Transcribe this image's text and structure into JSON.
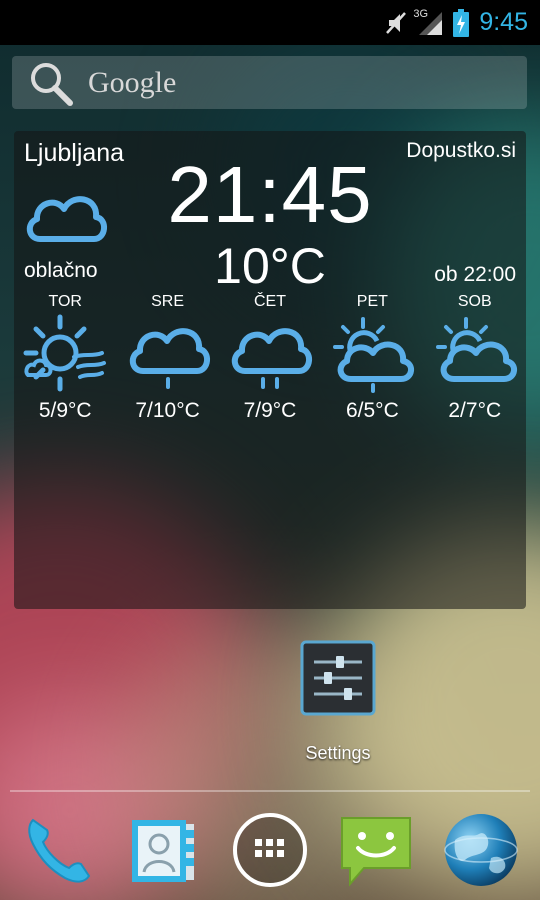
{
  "status_bar": {
    "network_label": "3G",
    "time": "9:45",
    "icons": [
      "muted-icon",
      "signal-icon",
      "battery-charging-icon"
    ]
  },
  "search": {
    "placeholder": "Google"
  },
  "weather": {
    "city": "Ljubljana",
    "provider": "Dopustko.si",
    "clock": "21:45",
    "temperature": "10°C",
    "condition": "oblačno",
    "updated": "ob 22:00",
    "current_icon": "cloud-icon",
    "forecast": [
      {
        "day": "TOR",
        "range": "5/9°C",
        "icon": "sun-cloud-wind-icon"
      },
      {
        "day": "SRE",
        "range": "7/10°C",
        "icon": "cloud-rain-icon"
      },
      {
        "day": "ČET",
        "range": "7/9°C",
        "icon": "cloud-rain-icon"
      },
      {
        "day": "PET",
        "range": "6/5°C",
        "icon": "partly-cloudy-icon"
      },
      {
        "day": "SOB",
        "range": "2/7°C",
        "icon": "partly-cloudy-icon"
      }
    ]
  },
  "shortcuts": {
    "settings_label": "Settings"
  },
  "dock": {
    "items": [
      "phone-icon",
      "contacts-icon",
      "app-drawer-icon",
      "messaging-icon",
      "browser-icon"
    ]
  },
  "colors": {
    "accent": "#33b5e5",
    "weather_icon": "#5aaee8"
  }
}
